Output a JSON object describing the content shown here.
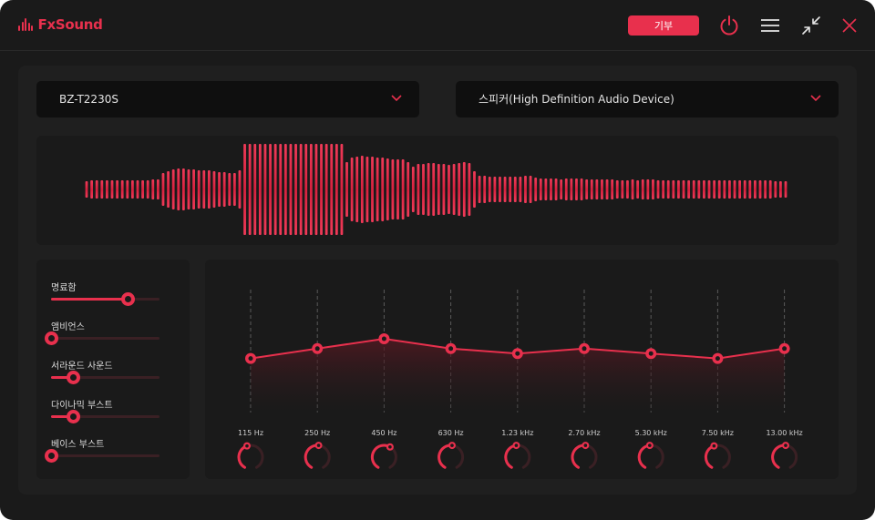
{
  "app": {
    "name": "FxSound"
  },
  "titlebar": {
    "donate_label": "기부",
    "icons": [
      "power-icon",
      "menu-icon",
      "minimize-icon",
      "close-icon"
    ]
  },
  "colors": {
    "accent": "#e8304d",
    "background": "#1a1a1a",
    "panel": "#1f1f1f",
    "dropdown": "#0f0f0f"
  },
  "presets": {
    "selected": "BZ-T2230S"
  },
  "output_device": {
    "selected": "스피커(High Definition Audio Device)"
  },
  "effects": [
    {
      "label": "명료함",
      "value": 0.71
    },
    {
      "label": "앰비언스",
      "value": 0.0
    },
    {
      "label": "서라운드 사운드",
      "value": 0.2
    },
    {
      "label": "다이나믹 부스트",
      "value": 0.2
    },
    {
      "label": "베이스 부스트",
      "value": 0.0
    }
  ],
  "equalizer": {
    "bands": [
      {
        "freq": "115 Hz",
        "level": 0.44
      },
      {
        "freq": "250 Hz",
        "level": 0.52
      },
      {
        "freq": "450 Hz",
        "level": 0.6
      },
      {
        "freq": "630 Hz",
        "level": 0.52
      },
      {
        "freq": "1.23 kHz",
        "level": 0.48
      },
      {
        "freq": "2.70 kHz",
        "level": 0.52
      },
      {
        "freq": "5.30 kHz",
        "level": 0.48
      },
      {
        "freq": "7.50 kHz",
        "level": 0.44
      },
      {
        "freq": "13.00 kHz",
        "level": 0.52
      }
    ]
  },
  "visualizer": {
    "levels": [
      0.18,
      0.2,
      0.2,
      0.2,
      0.2,
      0.2,
      0.2,
      0.2,
      0.2,
      0.2,
      0.2,
      0.2,
      0.2,
      0.22,
      0.22,
      0.36,
      0.4,
      0.44,
      0.46,
      0.46,
      0.44,
      0.44,
      0.42,
      0.42,
      0.42,
      0.4,
      0.38,
      0.38,
      0.36,
      0.36,
      0.42,
      1.0,
      1.0,
      1.0,
      1.0,
      1.0,
      1.0,
      1.0,
      1.0,
      1.0,
      1.0,
      1.0,
      1.0,
      1.0,
      1.0,
      1.0,
      1.0,
      1.0,
      1.0,
      1.0,
      1.0,
      0.6,
      0.7,
      0.72,
      0.74,
      0.72,
      0.72,
      0.7,
      0.7,
      0.68,
      0.66,
      0.66,
      0.66,
      0.6,
      0.5,
      0.56,
      0.56,
      0.58,
      0.58,
      0.56,
      0.56,
      0.54,
      0.56,
      0.58,
      0.6,
      0.58,
      0.4,
      0.3,
      0.3,
      0.28,
      0.28,
      0.28,
      0.28,
      0.28,
      0.28,
      0.28,
      0.3,
      0.3,
      0.26,
      0.24,
      0.24,
      0.24,
      0.24,
      0.22,
      0.24,
      0.24,
      0.24,
      0.24,
      0.22,
      0.22,
      0.22,
      0.22,
      0.22,
      0.22,
      0.2,
      0.2,
      0.2,
      0.22,
      0.2,
      0.22,
      0.22,
      0.22,
      0.2,
      0.2,
      0.2,
      0.2,
      0.2,
      0.2,
      0.2,
      0.2,
      0.2,
      0.2,
      0.2,
      0.2,
      0.2,
      0.2,
      0.2,
      0.2,
      0.2,
      0.2,
      0.2,
      0.2,
      0.2,
      0.2,
      0.2,
      0.18,
      0.18,
      0.18
    ]
  }
}
